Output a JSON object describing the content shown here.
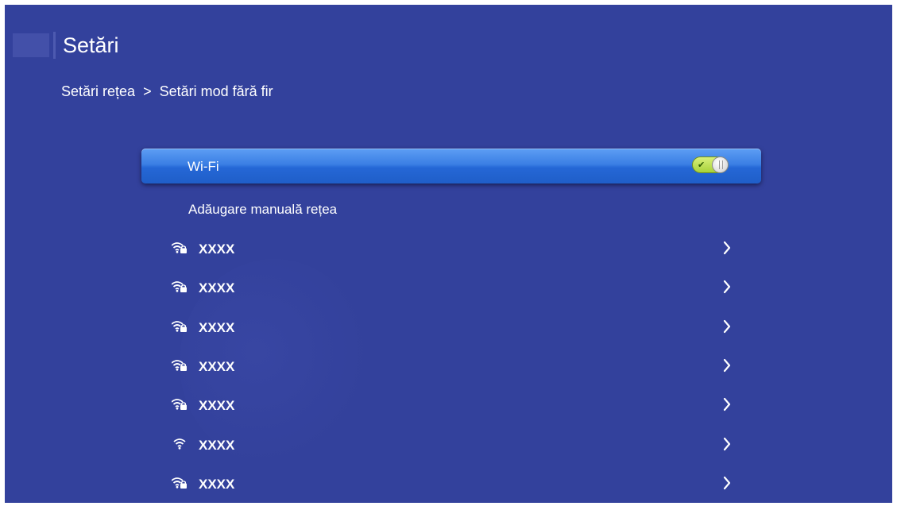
{
  "header": {
    "title": "Setări"
  },
  "breadcrumb": {
    "parent": "Setări rețea",
    "separator": ">",
    "current": "Setări mod fără fir"
  },
  "wifi": {
    "label": "Wi-Fi",
    "enabled": true,
    "toggle_icon": "check-icon"
  },
  "manual": {
    "label": "Adăugare manuală rețea"
  },
  "networks": [
    {
      "name": "XXXX",
      "secured": true
    },
    {
      "name": "XXXX",
      "secured": true
    },
    {
      "name": "XXXX",
      "secured": true
    },
    {
      "name": "XXXX",
      "secured": true
    },
    {
      "name": "XXXX",
      "secured": true
    },
    {
      "name": "XXXX",
      "secured": false
    },
    {
      "name": "XXXX",
      "secured": true
    }
  ],
  "colors": {
    "background": "#33419c",
    "highlight": "#2f72de",
    "toggle_on": "#b8de4a"
  }
}
